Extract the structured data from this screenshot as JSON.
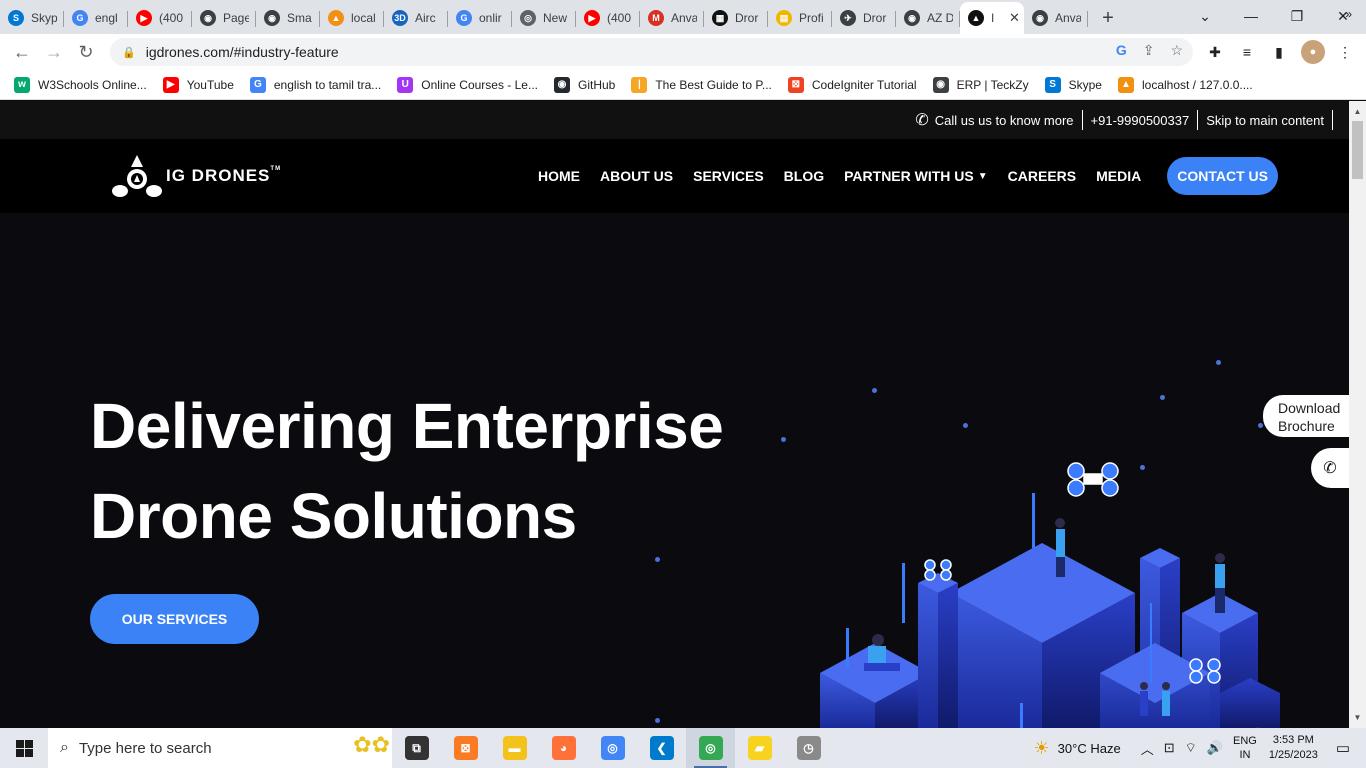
{
  "browser": {
    "tabs": [
      {
        "label": "Skyp",
        "icon": "skype-icon",
        "color": "#0078d4",
        "glyph": "S"
      },
      {
        "label": "engl",
        "icon": "google-icon",
        "color": "#4285f4",
        "glyph": "G"
      },
      {
        "label": "(400",
        "icon": "youtube-icon",
        "color": "#ff0000",
        "glyph": "▶"
      },
      {
        "label": "Page",
        "icon": "globe-icon",
        "color": "#3c4043",
        "glyph": "◉"
      },
      {
        "label": "Sma",
        "icon": "globe-icon",
        "color": "#3c4043",
        "glyph": "◉"
      },
      {
        "label": "local",
        "icon": "phpmyadmin-icon",
        "color": "#f29111",
        "glyph": "▲"
      },
      {
        "label": "Airc",
        "icon": "3d-icon",
        "color": "#1565c0",
        "glyph": "3D"
      },
      {
        "label": "onlir",
        "icon": "google-icon",
        "color": "#4285f4",
        "glyph": "G"
      },
      {
        "label": "New",
        "icon": "chrome-icon",
        "color": "#5f6368",
        "glyph": "◎"
      },
      {
        "label": "(400",
        "icon": "youtube-icon",
        "color": "#ff0000",
        "glyph": "▶"
      },
      {
        "label": "Anva",
        "icon": "gmail-icon",
        "color": "#d93025",
        "glyph": "M"
      },
      {
        "label": "Dror",
        "icon": "drone-checker-icon",
        "color": "#111111",
        "glyph": "▦"
      },
      {
        "label": "Profi",
        "icon": "profile-icon",
        "color": "#f2b600",
        "glyph": "▤"
      },
      {
        "label": "Dror",
        "icon": "drone-icon",
        "color": "#3c4043",
        "glyph": "✈"
      },
      {
        "label": "AZ D",
        "icon": "globe-icon",
        "color": "#3c4043",
        "glyph": "◉"
      },
      {
        "label": "I",
        "icon": "igdrones-icon",
        "color": "#111111",
        "glyph": "▲",
        "active": true
      },
      {
        "label": "Anva",
        "icon": "globe-icon",
        "color": "#3c4043",
        "glyph": "◉"
      }
    ],
    "url": "igdrones.com/#industry-feature",
    "bookmarks": [
      {
        "label": "W3Schools Online...",
        "icon": "w3schools-icon",
        "color": "#04aa6d",
        "glyph": "w"
      },
      {
        "label": "YouTube",
        "icon": "youtube-icon",
        "color": "#ff0000",
        "glyph": "▶"
      },
      {
        "label": "english to tamil tra...",
        "icon": "google-icon",
        "color": "#4285f4",
        "glyph": "G"
      },
      {
        "label": "Online Courses - Le...",
        "icon": "courses-icon",
        "color": "#a435f0",
        "glyph": "U"
      },
      {
        "label": "GitHub",
        "icon": "github-icon",
        "color": "#24292f",
        "glyph": "◉"
      },
      {
        "label": "The Best Guide to P...",
        "icon": "guide-icon",
        "color": "#f5a623",
        "glyph": "|"
      },
      {
        "label": "CodeIgniter Tutorial",
        "icon": "codeigniter-icon",
        "color": "#ee4323",
        "glyph": "⊠"
      },
      {
        "label": "ERP | TeckZy",
        "icon": "globe-icon",
        "color": "#3c4043",
        "glyph": "◉"
      },
      {
        "label": "Skype",
        "icon": "skype-icon",
        "color": "#0078d4",
        "glyph": "S"
      },
      {
        "label": "localhost / 127.0.0....",
        "icon": "phpmyadmin-icon",
        "color": "#f29111",
        "glyph": "▲"
      }
    ]
  },
  "site": {
    "topbar": {
      "call_text": "Call us us to know more",
      "phone": "+91-9990500337",
      "skip": "Skip to main content"
    },
    "logo_text": "IG DRONES",
    "logo_tm": "TM",
    "nav": [
      "HOME",
      "ABOUT US",
      "SERVICES",
      "BLOG",
      "PARTNER WITH US",
      "CAREERS",
      "MEDIA"
    ],
    "contact_label": "CONTACT US",
    "hero": {
      "title_line1": "Delivering Enterprise",
      "title_line2": "Drone Solutions",
      "cta": "OUR SERVICES"
    },
    "brochure_line1": "Download",
    "brochure_line2": "Brochure",
    "accent": "#3b82f6"
  },
  "taskbar": {
    "search_placeholder": "Type here to search",
    "apps": [
      {
        "name": "task-view-icon",
        "color": "#333333",
        "glyph": "⧉"
      },
      {
        "name": "xampp-icon",
        "color": "#fb7a24",
        "glyph": "⊠"
      },
      {
        "name": "file-explorer-icon",
        "color": "#f3c21b",
        "glyph": "▬"
      },
      {
        "name": "firefox-icon",
        "color": "#ff7139",
        "glyph": "◕"
      },
      {
        "name": "chrome-icon",
        "color": "#4285f4",
        "glyph": "◎"
      },
      {
        "name": "vscode-icon",
        "color": "#007acc",
        "glyph": "❮"
      },
      {
        "name": "chrome-profile-icon",
        "color": "#34a853",
        "glyph": "◎",
        "active": true
      },
      {
        "name": "sticky-notes-icon",
        "color": "#f7d21e",
        "glyph": "▰"
      },
      {
        "name": "clock-app-icon",
        "color": "#8a8a8a",
        "glyph": "◷"
      }
    ],
    "weather": "30°C  Haze",
    "lang_line1": "ENG",
    "lang_line2": "IN",
    "time": "3:53 PM",
    "date": "1/25/2023"
  }
}
